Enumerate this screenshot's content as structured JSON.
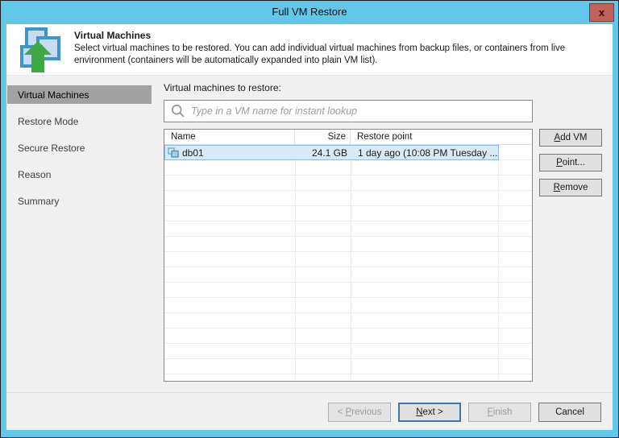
{
  "window": {
    "title": "Full VM Restore",
    "close_label": "x"
  },
  "header": {
    "title": "Virtual Machines",
    "description": "Select virtual machines to be restored. You can add individual virtual machines from backup files, or containers from live environment (containers will be automatically expanded into plain VM list)."
  },
  "sidebar": {
    "items": [
      {
        "label": "Virtual Machines",
        "selected": true
      },
      {
        "label": "Restore Mode",
        "selected": false
      },
      {
        "label": "Secure Restore",
        "selected": false
      },
      {
        "label": "Reason",
        "selected": false
      },
      {
        "label": "Summary",
        "selected": false
      }
    ]
  },
  "content": {
    "list_label": "Virtual machines to restore:",
    "search": {
      "placeholder": "Type in a VM name for instant lookup"
    },
    "table": {
      "columns": [
        "Name",
        "Size",
        "Restore point"
      ],
      "rows": [
        {
          "name": "db01",
          "size": "24.1 GB",
          "restore_point": "1 day ago (10:08 PM Tuesday ..."
        }
      ]
    },
    "side_buttons": [
      {
        "pre": "",
        "key": "A",
        "post": "dd VM"
      },
      {
        "pre": "",
        "key": "P",
        "post": "oint..."
      },
      {
        "pre": "",
        "key": "R",
        "post": "emove"
      }
    ]
  },
  "footer": {
    "previous": {
      "pre": "< ",
      "key": "P",
      "post": "revious",
      "disabled": true
    },
    "next": {
      "pre": "",
      "key": "N",
      "post": "ext >",
      "disabled": false,
      "focused": true
    },
    "finish": {
      "pre": "",
      "key": "F",
      "post": "inish",
      "disabled": true
    },
    "cancel": {
      "label": "Cancel",
      "disabled": false
    }
  },
  "colors": {
    "titlebar_blue": "#62C8EA",
    "close_button_red": "#C2605A",
    "selection_blue": "#D8EAF9",
    "selected_nav_gray": "#A2A2A2",
    "arrow_green": "#3FA845",
    "icon_square_blue": "#3E96C8"
  }
}
